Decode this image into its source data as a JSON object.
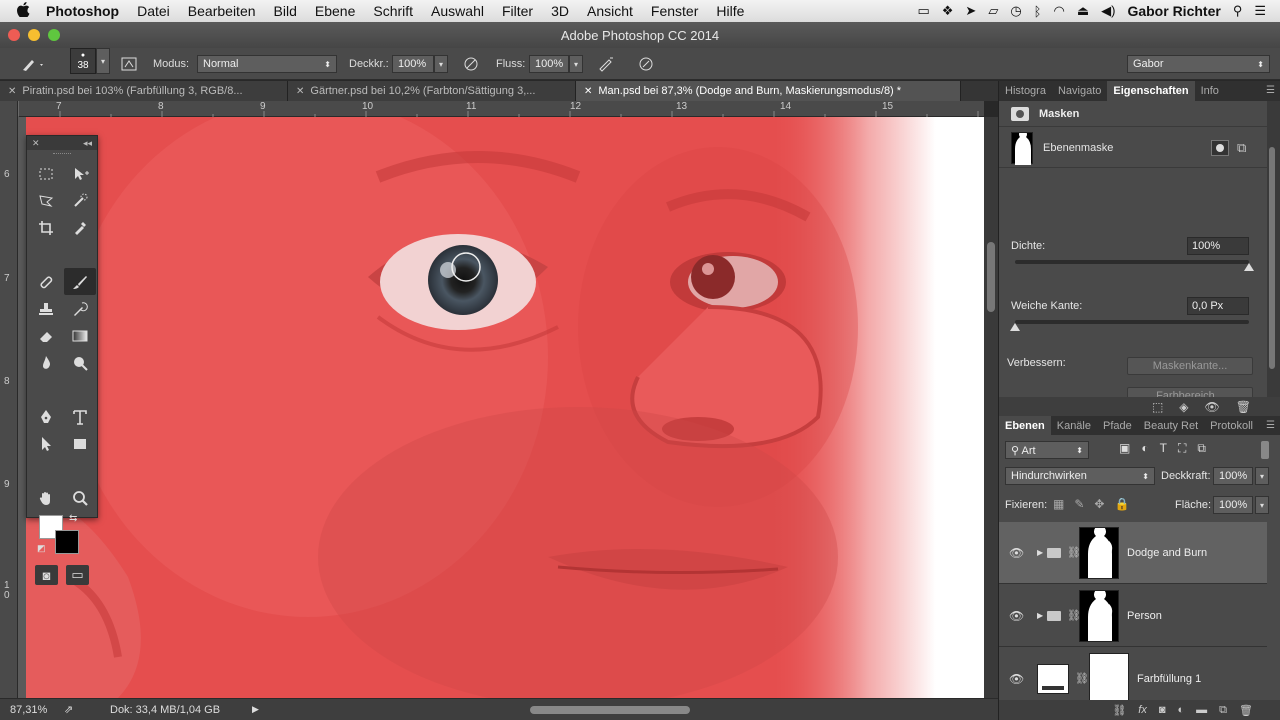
{
  "menubar": {
    "apple": "",
    "app": "Photoshop",
    "items": [
      "Datei",
      "Bearbeiten",
      "Bild",
      "Ebene",
      "Schrift",
      "Auswahl",
      "Filter",
      "3D",
      "Ansicht",
      "Fenster",
      "Hilfe"
    ],
    "user": "Gabor Richter"
  },
  "window": {
    "title": "Adobe Photoshop CC 2014"
  },
  "options": {
    "brush_size": "38",
    "mode_label": "Modus:",
    "mode_value": "Normal",
    "opacity_label": "Deckkr.:",
    "opacity_value": "100%",
    "flow_label": "Fluss:",
    "flow_value": "100%",
    "workspace": "Gabor"
  },
  "doc_tabs": [
    {
      "label": "Piratin.psd bei 103% (Farbfüllung 3, RGB/8..."
    },
    {
      "label": "Gärtner.psd bei 10,2% (Farbton/Sättigung 3,..."
    },
    {
      "label": "Man.psd bei 87,3% (Dodge and Burn, Maskierungsmodus/8) *"
    }
  ],
  "ruler": {
    "h": [
      "7",
      "8",
      "9",
      "10",
      "11",
      "12",
      "13",
      "14",
      "15"
    ],
    "v": [
      "6",
      "7",
      "8",
      "9",
      "1 0"
    ]
  },
  "status": {
    "zoom": "87,31%",
    "doc": "Dok: 33,4 MB/1,04 GB"
  },
  "top_panel": {
    "tabs": [
      "Histogra",
      "Navigato",
      "Eigenschaften",
      "Info"
    ],
    "section_title": "Masken",
    "mask_name": "Ebenenmaske",
    "density_label": "Dichte:",
    "density_value": "100%",
    "density_fraction": 1.0,
    "feather_label": "Weiche Kante:",
    "feather_value": "0,0 Px",
    "feather_fraction": 0.0,
    "refine_label": "Verbessern:",
    "refine_button_1": "Maskenkante...",
    "refine_button_2": "Farbbereich..."
  },
  "layers_panel": {
    "tabs": [
      "Ebenen",
      "Kanäle",
      "Pfade",
      "Beauty Ret",
      "Protokoll"
    ],
    "filter_value": "Art",
    "blend_mode": "Hindurchwirken",
    "opacity_label": "Deckkraft:",
    "opacity_value": "100%",
    "lock_label": "Fixieren:",
    "fill_label": "Fläche:",
    "fill_value": "100%",
    "layers": [
      {
        "name": "Dodge and Burn",
        "selected": true
      },
      {
        "name": "Person",
        "selected": false
      },
      {
        "name": "Farbfüllung 1",
        "selected": false
      }
    ]
  },
  "colors": {
    "mask_overlay": "#e85454",
    "foreground": "#ffffff",
    "background": "#000000"
  }
}
